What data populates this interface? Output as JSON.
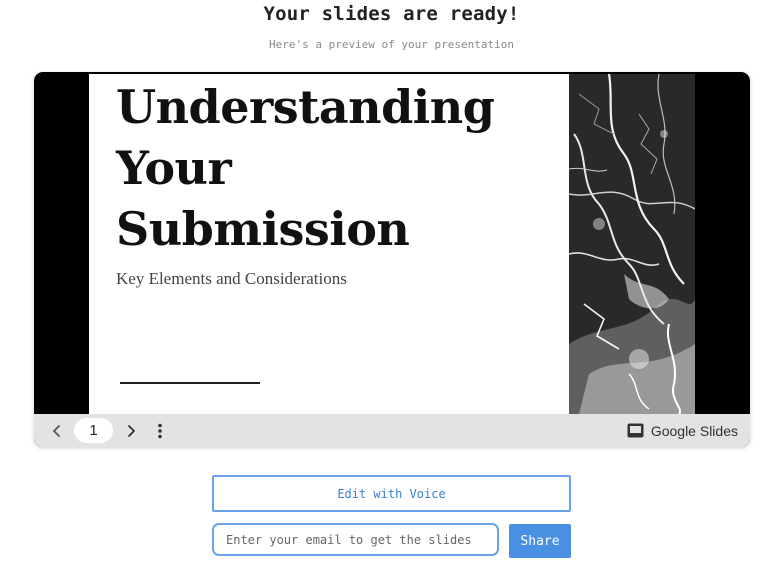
{
  "header": {
    "title": "Your slides are ready!",
    "subtitle": "Here's a preview of your presentation"
  },
  "slide": {
    "title_lines": [
      "Understanding",
      "Your",
      "Submission"
    ],
    "subtitle": "Key Elements and Considerations",
    "image": "black-and-white-marble-texture"
  },
  "viewer_toolbar": {
    "prev_icon": "chevron-left-icon",
    "page_number": "1",
    "next_icon": "chevron-right-icon",
    "more_icon": "more-vertical-icon",
    "brand_icon": "google-slides-icon",
    "brand_label": "Google Slides"
  },
  "actions": {
    "edit_voice_label": "Edit with Voice",
    "email_placeholder": "Enter your email to get the slides",
    "email_value": "",
    "share_label": "Share"
  },
  "colors": {
    "accent": "#4a90e2",
    "accent_border": "#6aa3e8",
    "toolbar_bg": "#e3e3e3"
  }
}
